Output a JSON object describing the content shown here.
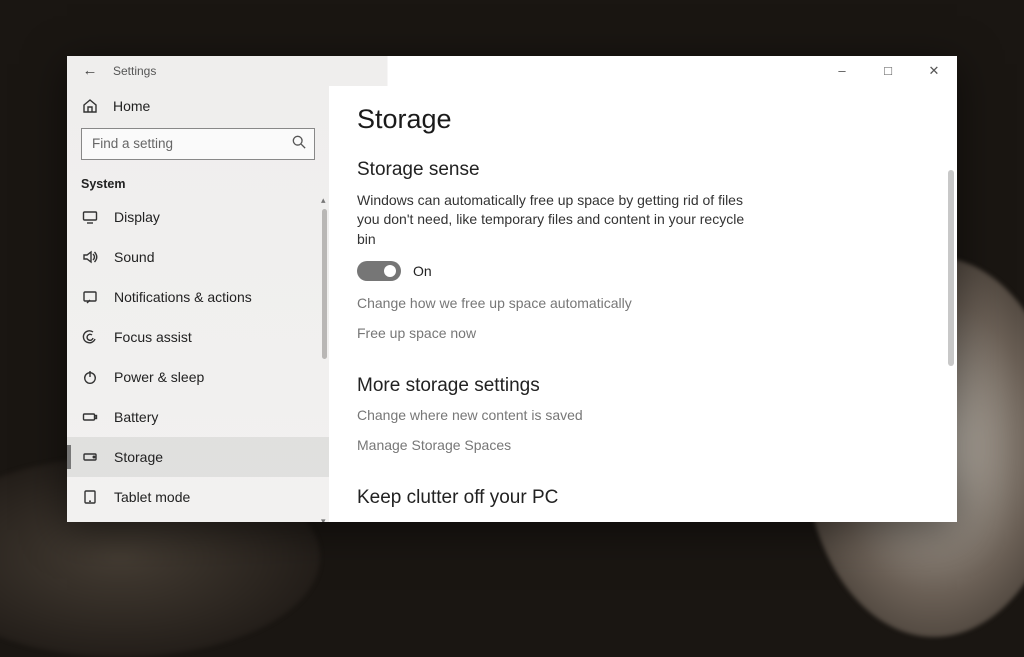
{
  "app_title": "Settings",
  "search": {
    "placeholder": "Find a setting"
  },
  "home_label": "Home",
  "section_label": "System",
  "nav": {
    "display": "Display",
    "sound": "Sound",
    "notifications": "Notifications & actions",
    "focus": "Focus assist",
    "power": "Power & sleep",
    "battery": "Battery",
    "storage": "Storage",
    "tablet": "Tablet mode"
  },
  "page": {
    "title": "Storage",
    "sense_title": "Storage sense",
    "sense_desc": "Windows can automatically free up space by getting rid of files you don't need, like temporary files and content in your recycle bin",
    "toggle_state": "On",
    "link_change_auto": "Change how we free up space automatically",
    "link_free_now": "Free up space now",
    "more_title": "More storage settings",
    "link_change_where": "Change where new content is saved",
    "link_manage_spaces": "Manage Storage Spaces",
    "clutter_title": "Keep clutter off your PC"
  }
}
